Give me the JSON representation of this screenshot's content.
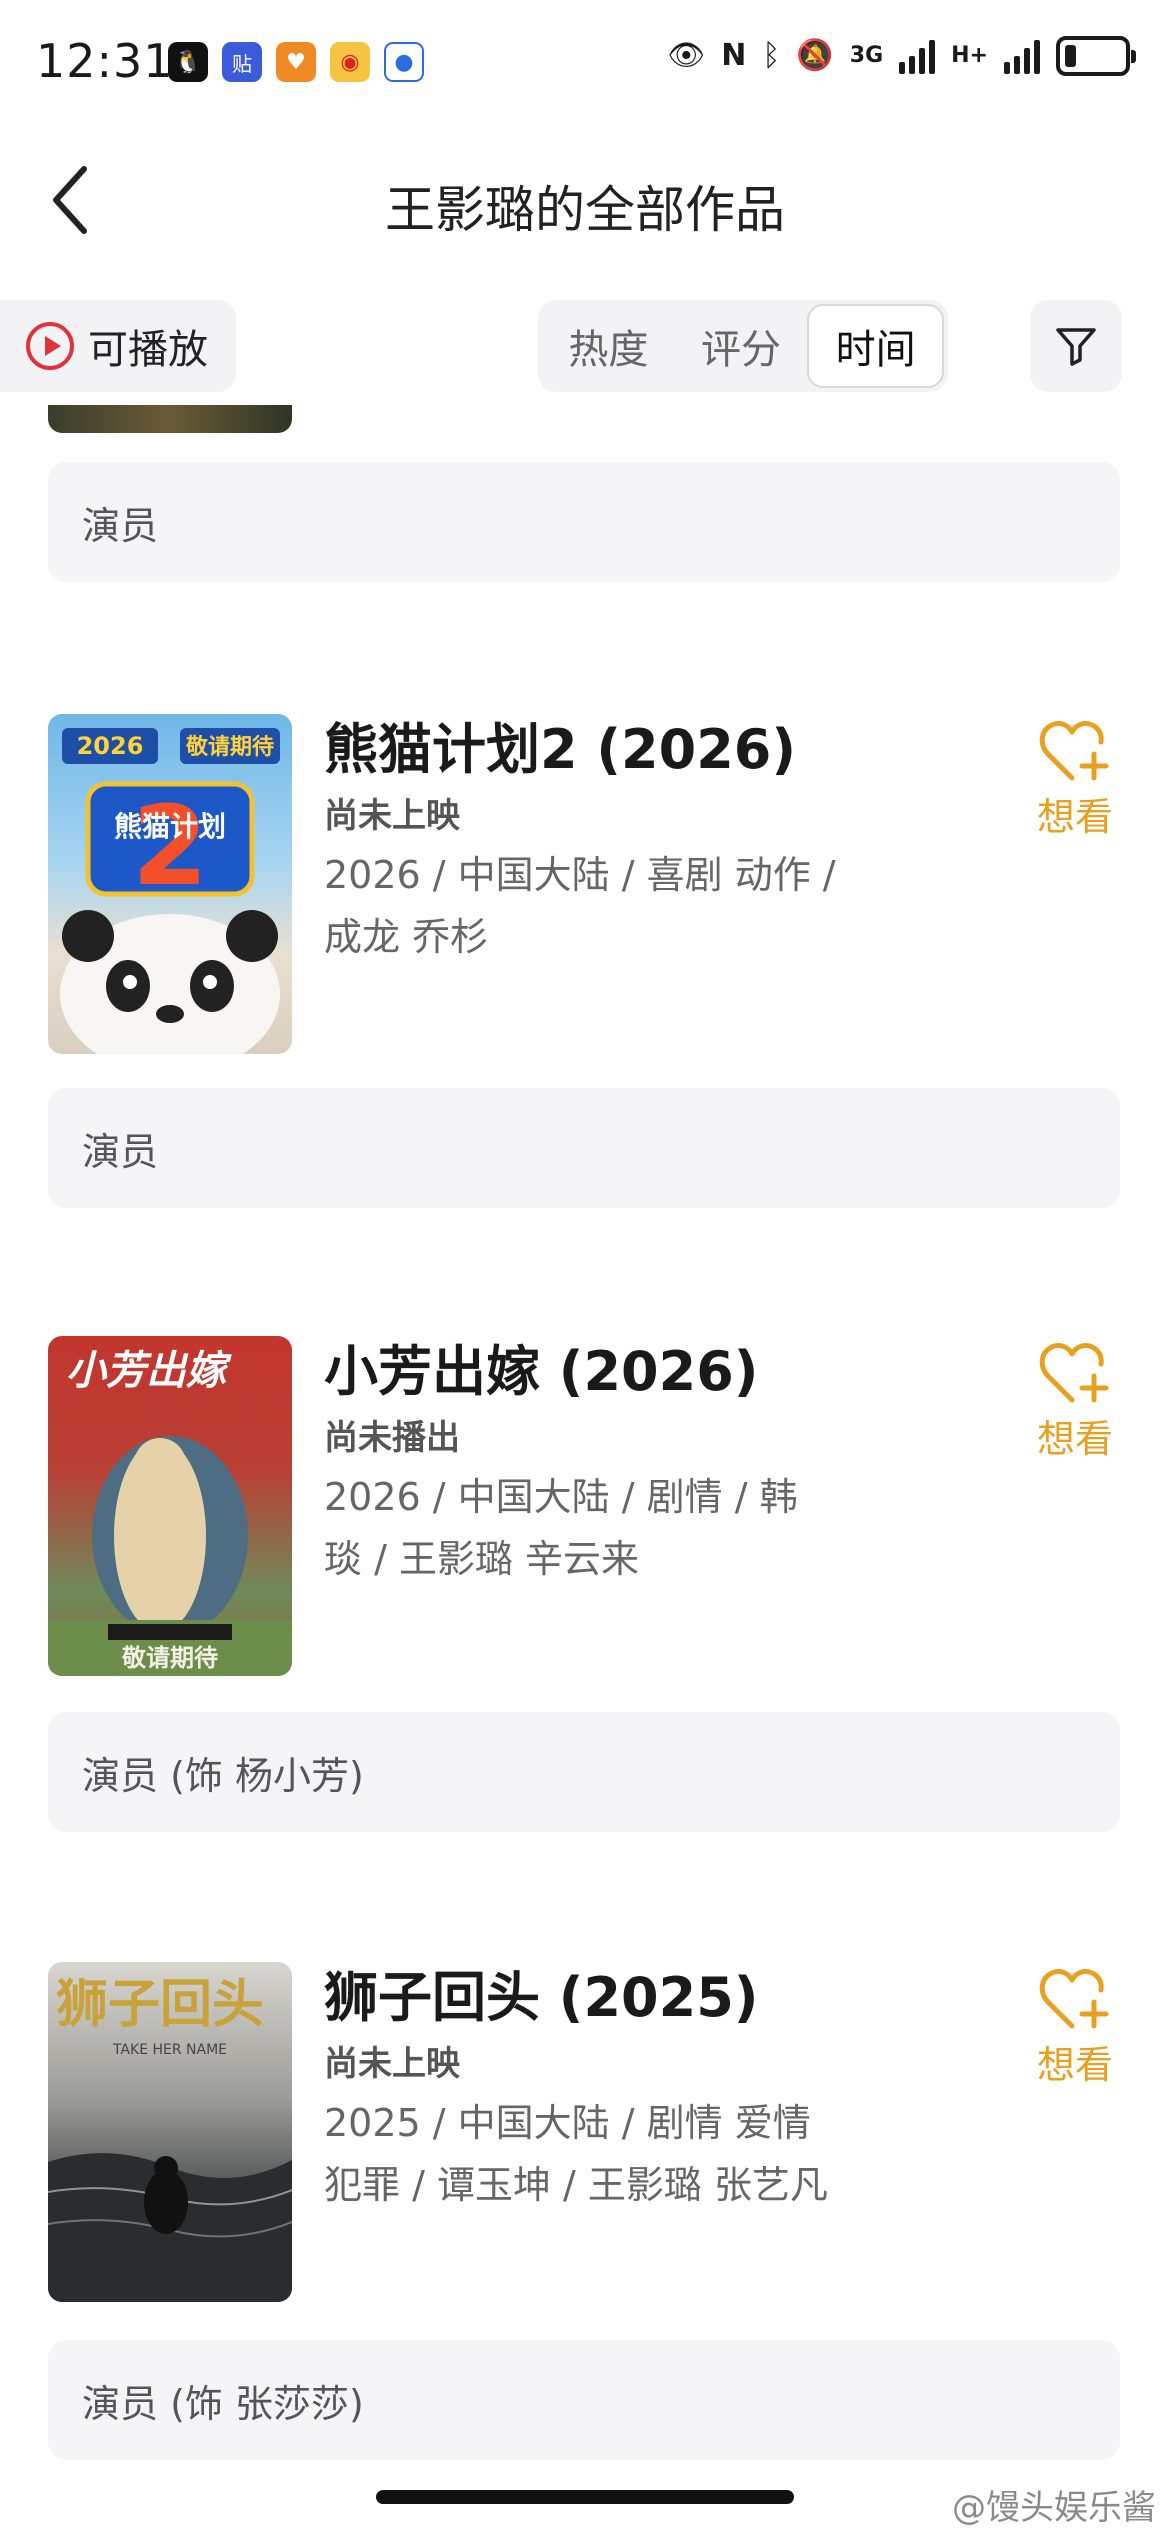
{
  "status_bar": {
    "time": "12:31",
    "apps": [
      "qq-icon",
      "tieba-icon",
      "heart-app-icon",
      "weibo-icon",
      "app-icon"
    ],
    "network": "3G",
    "network2": "H+",
    "battery_level": 0.2
  },
  "header": {
    "title": "王影璐的全部作品"
  },
  "filters": {
    "playable_label": "可播放",
    "sort_tabs": [
      "热度",
      "评分",
      "时间"
    ],
    "active_sort": "时间"
  },
  "top_role": "演员",
  "works": [
    {
      "title": "熊猫计划2 (2026)",
      "status": "尚未上映",
      "meta_line1": "2026 / 中国大陆 / 喜剧 动作 /",
      "meta_line2": "成龙 乔杉",
      "want_label": "想看",
      "role": "演员",
      "poster_badge_year": "2026",
      "poster_badge_text": "敬请期待",
      "poster_title": "熊猫计划"
    },
    {
      "title": "小芳出嫁 (2026)",
      "status": "尚未播出",
      "meta_line1": "2026 / 中国大陆 / 剧情 / 韩",
      "meta_line2": "琰 / 王影璐 辛云来",
      "want_label": "想看",
      "role": "演员 (饰 杨小芳)",
      "poster_title": "小芳出嫁",
      "poster_footer": "敬请期待"
    },
    {
      "title": "狮子回头 (2025)",
      "status": "尚未上映",
      "meta_line1": "2025 / 中国大陆 / 剧情 爱情",
      "meta_line2": "犯罪 / 谭玉坤 / 王影璐 张艺凡",
      "want_label": "想看",
      "role": "演员 (饰 张莎莎)",
      "poster_title": "狮子回头",
      "poster_subtitle": "TAKE HER NAME"
    }
  ],
  "watermark": "@馒头娱乐酱",
  "colors": {
    "accent": "#e8a020",
    "play_red": "#e0343c"
  }
}
